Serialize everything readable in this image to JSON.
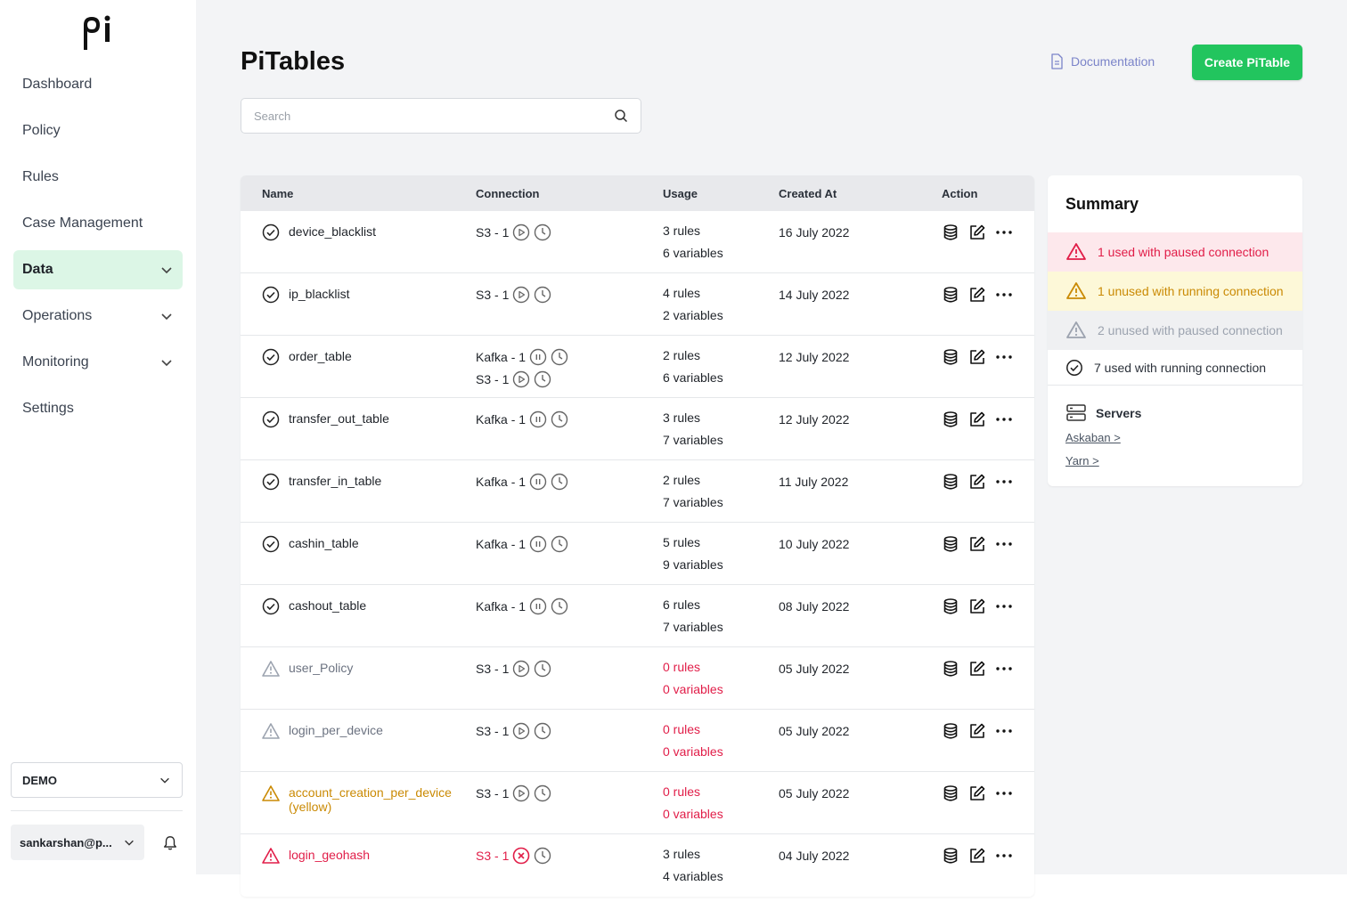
{
  "sidebar": {
    "logo_text": "pi",
    "items": [
      {
        "label": "Dashboard",
        "expandable": false,
        "active": false
      },
      {
        "label": "Policy",
        "expandable": false,
        "active": false
      },
      {
        "label": "Rules",
        "expandable": false,
        "active": false
      },
      {
        "label": "Case Management",
        "expandable": false,
        "active": false
      },
      {
        "label": "Data",
        "expandable": true,
        "active": true
      },
      {
        "label": "Operations",
        "expandable": true,
        "active": false
      },
      {
        "label": "Monitoring",
        "expandable": true,
        "active": false
      },
      {
        "label": "Settings",
        "expandable": false,
        "active": false
      }
    ],
    "environment": "DEMO",
    "user": "sankarshan@p..."
  },
  "header": {
    "title": "PiTables",
    "documentation_label": "Documentation",
    "create_label": "Create PiTable"
  },
  "search": {
    "placeholder": "Search",
    "value": ""
  },
  "table": {
    "columns": [
      "Name",
      "Connection",
      "Usage",
      "Created At",
      "Action"
    ],
    "rows": [
      {
        "name": "device_blacklist",
        "status": "ok",
        "connections": [
          {
            "label": "S3 - 1",
            "state": "play"
          }
        ],
        "rules": "3 rules",
        "variables": "6 variables",
        "created": "16 July 2022"
      },
      {
        "name": "ip_blacklist",
        "status": "ok",
        "connections": [
          {
            "label": "S3 - 1",
            "state": "play"
          }
        ],
        "rules": "4 rules",
        "variables": "2 variables",
        "created": "14 July 2022"
      },
      {
        "name": "order_table",
        "status": "ok",
        "connections": [
          {
            "label": "Kafka - 1",
            "state": "pause"
          },
          {
            "label": "S3 - 1",
            "state": "play"
          }
        ],
        "rules": "2 rules",
        "variables": "6 variables",
        "created": "12 July 2022"
      },
      {
        "name": "transfer_out_table",
        "status": "ok",
        "connections": [
          {
            "label": "Kafka - 1",
            "state": "pause"
          }
        ],
        "rules": "3 rules",
        "variables": "7 variables",
        "created": "12 July 2022"
      },
      {
        "name": "transfer_in_table",
        "status": "ok",
        "connections": [
          {
            "label": "Kafka - 1",
            "state": "pause"
          }
        ],
        "rules": "2 rules",
        "variables": "7 variables",
        "created": "11 July 2022"
      },
      {
        "name": "cashin_table",
        "status": "ok",
        "connections": [
          {
            "label": "Kafka - 1",
            "state": "pause"
          }
        ],
        "rules": "5 rules",
        "variables": "9 variables",
        "created": "10 July 2022"
      },
      {
        "name": "cashout_table",
        "status": "ok",
        "connections": [
          {
            "label": "Kafka - 1",
            "state": "pause"
          }
        ],
        "rules": "6 rules",
        "variables": "7 variables",
        "created": "08 July 2022"
      },
      {
        "name": "user_Policy",
        "status": "gray",
        "connections": [
          {
            "label": "S3 - 1",
            "state": "play"
          }
        ],
        "rules": "0 rules",
        "variables": "0 variables",
        "created": "05 July 2022"
      },
      {
        "name": "login_per_device",
        "status": "gray",
        "connections": [
          {
            "label": "S3 - 1",
            "state": "play"
          }
        ],
        "rules": "0 rules",
        "variables": "0 variables",
        "created": "05 July 2022"
      },
      {
        "name": "account_creation_per_device (yellow)",
        "status": "yellow",
        "connections": [
          {
            "label": "S3 - 1",
            "state": "play"
          }
        ],
        "rules": "0 rules",
        "variables": "0 variables",
        "created": "05 July 2022"
      },
      {
        "name": "login_geohash",
        "status": "red",
        "connections": [
          {
            "label": "S3 - 1",
            "state": "error"
          }
        ],
        "rules": "3 rules",
        "variables": "4 variables",
        "created": "04 July 2022"
      }
    ]
  },
  "summary": {
    "title": "Summary",
    "used_paused": "1 used with paused connection",
    "unused_running": "1 unused with running connection",
    "unused_paused": "2 unused with paused connection",
    "used_running": "7 used with running connection",
    "servers_label": "Servers",
    "servers": [
      "Askaban >",
      "Yarn >"
    ]
  },
  "colors": {
    "accent_green": "#22c55e",
    "active_bg": "#dcf6e6",
    "error_red": "#e11d48",
    "warning_yellow": "#ca8a04",
    "muted_gray": "#9ca3af",
    "doc_link": "#7b84c9"
  }
}
